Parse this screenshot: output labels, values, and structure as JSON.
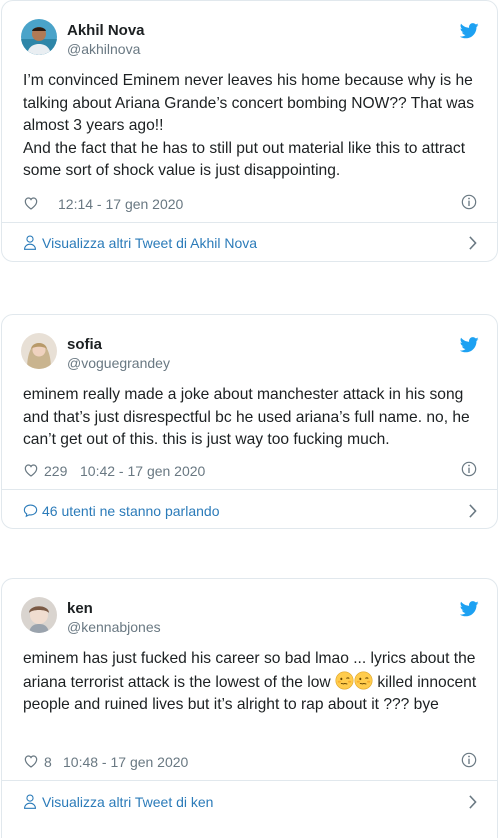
{
  "tweets": [
    {
      "name": "Akhil Nova",
      "handle": "@akhilnova",
      "text_lines": [
        "I’m convinced Eminem never leaves his home because why is he talking about Ariana Grande’s concert bombing NOW?? That was almost 3 years ago!!",
        "And the fact that he has to still put out material like this to attract some sort of shock value is just disappointing."
      ],
      "likes": "",
      "time": "12:14 - 17 gen 2020",
      "footer_label": "Visualizza altri Tweet di Akhil Nova",
      "footer_icon": "person-icon"
    },
    {
      "name": "sofia",
      "handle": "@voguegrandey",
      "text": "eminem really made a joke about manchester attack in his song and that’s just disrespectful bc he used ariana’s full name. no, he can’t get out of this. this is just way too fucking much.",
      "likes": "229",
      "time": "10:42 - 17 gen 2020",
      "footer_label": "46 utenti ne stanno parlando",
      "footer_icon": "speech-bubble-icon"
    },
    {
      "name": "ken",
      "handle": "@kennabjones",
      "text_before_emoji": "eminem has just fucked his career so bad lmao ... lyrics about the ariana terrorist attack is the lowest of the low ",
      "text_after_emoji": " killed innocent people and ruined lives but it’s alright to rap about it ??? bye",
      "likes": "8",
      "time": "10:48 - 17 gen 2020",
      "footer_label": "Visualizza altri Tweet di ken",
      "footer_icon": "person-icon"
    }
  ],
  "colors": {
    "link_blue": "#2b7bb9",
    "twitter_blue": "#1da1f2",
    "muted_gray": "#697882",
    "border": "#e1e8ed",
    "text": "#1c2022"
  }
}
